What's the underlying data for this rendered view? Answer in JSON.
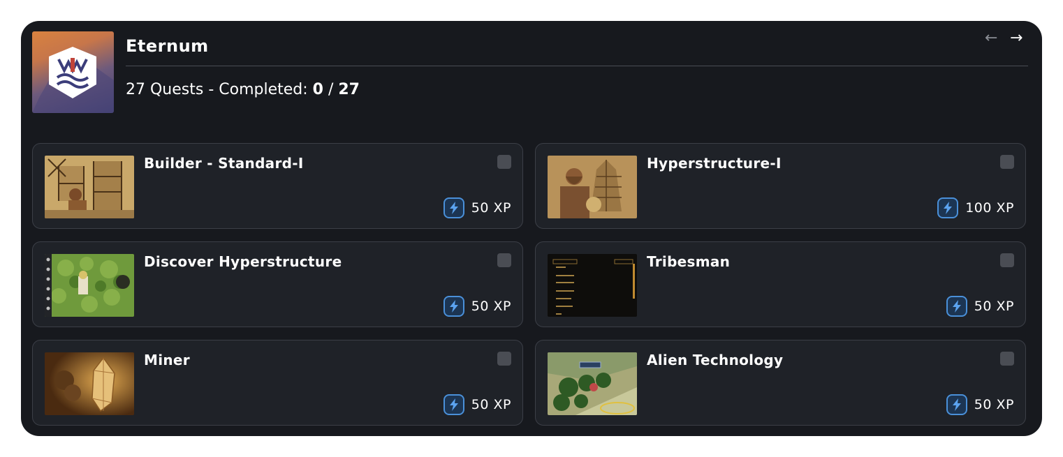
{
  "project": {
    "title": "Eternum",
    "summary_prefix": "27 Quests - Completed: ",
    "completed": "0",
    "separator": " / ",
    "total": "27",
    "nav_prev": "←",
    "nav_next": "→",
    "logo_icon": "eternum-crest-icon"
  },
  "colors": {
    "panel_bg": "#17191e",
    "card_bg": "#1f2228",
    "card_border": "#3c3f47",
    "xp_accent": "#4a90d9",
    "checkbox": "#4a4d54"
  },
  "quests": [
    {
      "title": "Builder - Standard-I",
      "xp": "50 XP",
      "thumb": "builder-image",
      "completed": false
    },
    {
      "title": "Hyperstructure-I",
      "xp": "100 XP",
      "thumb": "hyperstructure-image",
      "completed": false
    },
    {
      "title": "Discover Hyperstructure",
      "xp": "50 XP",
      "thumb": "map-hex-image",
      "completed": false
    },
    {
      "title": "Tribesman",
      "xp": "50 XP",
      "thumb": "tribe-menu-image",
      "completed": false
    },
    {
      "title": "Miner",
      "xp": "50 XP",
      "thumb": "crystal-mine-image",
      "completed": false
    },
    {
      "title": "Alien Technology",
      "xp": "50 XP",
      "thumb": "alien-map-image",
      "completed": false
    }
  ]
}
